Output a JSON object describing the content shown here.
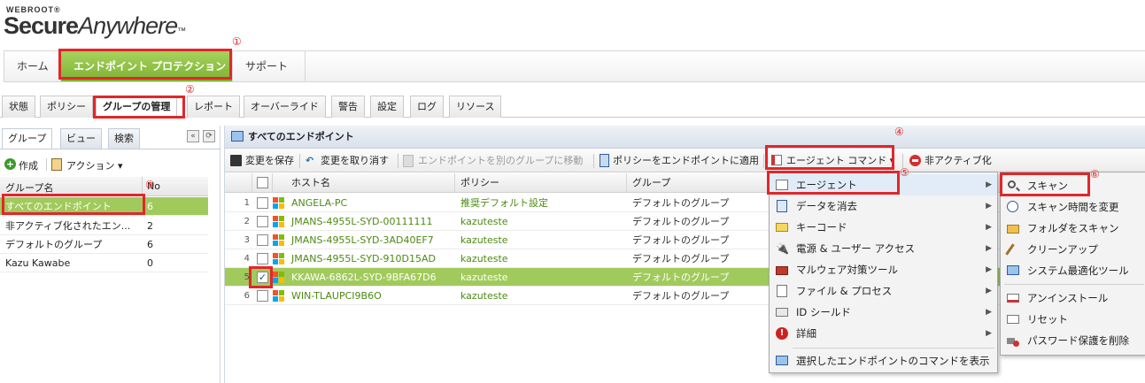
{
  "logo": {
    "brand": "WEBROOT",
    "reg": "®",
    "secure": "Secure",
    "anywhere": "Anywhere",
    "tm": "™"
  },
  "main_nav": {
    "home": "ホーム",
    "endpoint": "エンドポイント プロテクション",
    "support": "サポート"
  },
  "sub_tabs": [
    "状態",
    "ポリシー",
    "グループの管理",
    "レポート",
    "オーバーライド",
    "警告",
    "設定",
    "ログ",
    "リソース"
  ],
  "left": {
    "tabs": [
      "グループ",
      "ビュー",
      "検索"
    ],
    "collapse_icon": "«",
    "refresh_icon": "⟳",
    "toolbar": {
      "create": "作成",
      "action": "アクション"
    },
    "columns": {
      "name": "グループ名",
      "count": "No"
    },
    "groups": [
      {
        "name": "すべてのエンドポイント",
        "count": "6"
      },
      {
        "name": "非アクティブ化されたエン...",
        "count": "2"
      },
      {
        "name": "デフォルトのグループ",
        "count": "6"
      },
      {
        "name": "Kazu Kawabe",
        "count": "0"
      }
    ]
  },
  "right": {
    "title": "すべてのエンドポイント",
    "toolbar": {
      "save": "変更を保存",
      "undo": "変更を取り消す",
      "move": "エンドポイントを別のグループに移動",
      "apply_policy": "ポリシーをエンドポイントに適用",
      "agent_cmd": "エージェント コマンド",
      "deactivate": "非アクティブ化"
    },
    "columns": {
      "host": "ホスト名",
      "policy": "ポリシー",
      "group": "グループ"
    },
    "rows": [
      {
        "num": "1",
        "host": "ANGELA-PC",
        "policy": "推奨デフォルト設定",
        "group": "デフォルトのグループ",
        "checked": false
      },
      {
        "num": "2",
        "host": "JMANS-4955L-SYD-00111111",
        "policy": "kazuteste",
        "group": "デフォルトのグループ",
        "checked": false
      },
      {
        "num": "3",
        "host": "JMANS-4955L-SYD-3AD40EF7",
        "policy": "kazuteste",
        "group": "デフォルトのグループ",
        "checked": false
      },
      {
        "num": "4",
        "host": "JMANS-4955L-SYD-910D15AD",
        "policy": "kazuteste",
        "group": "デフォルトのグループ",
        "checked": false
      },
      {
        "num": "5",
        "host": "KKAWA-6862L-SYD-9BFA67D6",
        "policy": "kazuteste",
        "group": "デフォルトのグループ",
        "checked": true
      },
      {
        "num": "6",
        "host": "WIN-TLAUPCI9B6O",
        "policy": "kazuteste",
        "group": "デフォルトのグループ",
        "checked": false
      }
    ]
  },
  "agent_menu": [
    {
      "label": "エージェント",
      "icon": "agent-icon"
    },
    {
      "label": "データを消去",
      "icon": "erase-data-icon"
    },
    {
      "label": "キーコード",
      "icon": "keycode-icon"
    },
    {
      "label": "電源 & ユーザー アクセス",
      "icon": "power-plug-icon"
    },
    {
      "label": "マルウェア対策ツール",
      "icon": "toolbox-icon"
    },
    {
      "label": "ファイル & プロセス",
      "icon": "file-process-icon"
    },
    {
      "label": "ID シールド",
      "icon": "id-shield-icon"
    },
    {
      "label": "詳細",
      "icon": "advanced-icon"
    },
    {
      "label": "選択したエンドポイントのコマンドを表示",
      "icon": "monitor-icon"
    }
  ],
  "agent_submenu": [
    {
      "label": "スキャン",
      "icon": "magnifier-icon"
    },
    {
      "label": "スキャン時間を変更",
      "icon": "clock-icon"
    },
    {
      "label": "フォルダをスキャン",
      "icon": "folder-scan-icon"
    },
    {
      "label": "クリーンアップ",
      "icon": "broom-icon"
    },
    {
      "label": "システム最適化ツール",
      "icon": "optimizer-icon"
    },
    {
      "label": "アンインストール",
      "icon": "uninstall-icon"
    },
    {
      "label": "リセット",
      "icon": "reset-icon"
    },
    {
      "label": "パスワード保護を削除",
      "icon": "remove-password-icon"
    }
  ],
  "annotations": [
    "①",
    "②",
    "③",
    "④",
    "⑤",
    "⑥"
  ],
  "colors": {
    "accent_green": "#8cc63e",
    "annotation_red": "#e2262a",
    "link_green": "#4d8a12"
  }
}
